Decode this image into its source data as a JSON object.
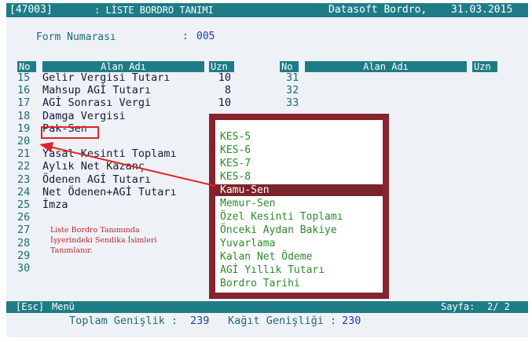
{
  "titlebar": {
    "code": "[47003]",
    "title": ": LİSTE BORDRO TANIMI",
    "app": "Datasoft Bordro,",
    "date": "31.03.2015"
  },
  "form": {
    "label": "Form Numarası",
    "sep": ":",
    "value": "005"
  },
  "headers": {
    "no": "No",
    "alan": "Alan Adı",
    "uzn": "Uzn"
  },
  "left_rows": [
    {
      "no": "15",
      "name": "Gelir Vergisi Tutarı",
      "uzn": "10"
    },
    {
      "no": "16",
      "name": "Mahsup AGİ Tutarı",
      "uzn": "8"
    },
    {
      "no": "17",
      "name": "AGİ Sonrası Vergi",
      "uzn": "10"
    },
    {
      "no": "18",
      "name": "Damga Vergisi",
      "uzn": ""
    },
    {
      "no": "19",
      "name": "Pak-Sen",
      "uzn": ""
    },
    {
      "no": "20",
      "name": "",
      "uzn": ""
    },
    {
      "no": "21",
      "name": "Yasal Kesinti Toplamı",
      "uzn": ""
    },
    {
      "no": "22",
      "name": "Aylık Net Kazanç",
      "uzn": ""
    },
    {
      "no": "23",
      "name": "Ödenen AGİ Tutarı",
      "uzn": ""
    },
    {
      "no": "24",
      "name": "Net Ödenen+AGİ Tutarı",
      "uzn": ""
    },
    {
      "no": "25",
      "name": "İmza",
      "uzn": ""
    },
    {
      "no": "26",
      "name": "",
      "uzn": ""
    },
    {
      "no": "27",
      "name": "",
      "uzn": ""
    },
    {
      "no": "28",
      "name": "",
      "uzn": ""
    },
    {
      "no": "29",
      "name": "",
      "uzn": ""
    },
    {
      "no": "30",
      "name": "",
      "uzn": ""
    }
  ],
  "right_rows": [
    "31",
    "32",
    "33"
  ],
  "popup_items": [
    "KES-5",
    "KES-6",
    "KES-7",
    "KES-8",
    "Kamu-Sen",
    "Memur-Sen",
    "Özel Kesinti Toplamı",
    "Önceki Aydan Bakiye",
    "Yuvarlama",
    "Kalan Net Ödeme",
    "AGİ Yıllık Tutarı",
    "Bordro Tarihi"
  ],
  "popup_selected_index": 4,
  "note": {
    "line1": "Liste Bordro Tanımında",
    "line2": "İşyerindeki Sendika İsimleri",
    "line3": "Tanımlanır."
  },
  "footer": {
    "esc": "[Esc]",
    "menu": "Menü",
    "page_label": "Sayfa:",
    "page_value": "2/ 2"
  },
  "totals": {
    "width_label": "Toplam Genişlik :",
    "width_value": "239",
    "paper_label": "Kağıt Genişliği :",
    "paper_value": "230"
  },
  "colors": {
    "bar": "#1e7c86",
    "popup_frame": "#86232c",
    "highlight": "#e02424"
  }
}
